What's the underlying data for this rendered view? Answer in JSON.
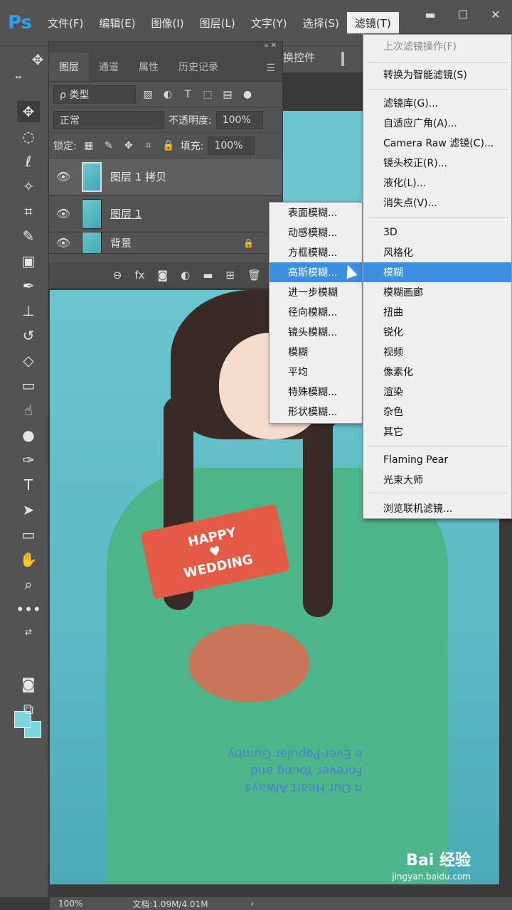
{
  "menubar": {
    "logo": "Ps",
    "items": [
      "文件(F)",
      "编辑(E)",
      "图像(I)",
      "图层(L)",
      "文字(Y)",
      "选择(S)",
      "滤镜(T)"
    ],
    "window_buttons": [
      "▬",
      "☐",
      "✕"
    ]
  },
  "options": {
    "partial_text": "换控件"
  },
  "layers_panel": {
    "tabs": [
      "图层",
      "通道",
      "属性",
      "历史记录"
    ],
    "filter_kind": "ρ 类型",
    "blend_mode": "正常",
    "opacity_label": "不透明度:",
    "opacity_value": "100%",
    "lock_label": "锁定:",
    "fill_label": "填充:",
    "fill_value": "100%",
    "layers": [
      {
        "name": "图层 1 拷贝",
        "selected": true
      },
      {
        "name": "图层 1",
        "selected": false
      },
      {
        "name": "背景",
        "selected": false
      }
    ],
    "footer_icons": [
      "link-icon",
      "fx-icon",
      "mask-icon",
      "adjustment-icon",
      "folder-icon",
      "new-layer-icon",
      "trash-icon"
    ]
  },
  "filter_menu": {
    "items": [
      {
        "label": "上次滤镜操作(F)",
        "disabled": true
      },
      {
        "label": "转换为智能滤镜(S)"
      },
      {
        "label": "滤镜库(G)..."
      },
      {
        "label": "自适应广角(A)..."
      },
      {
        "label": "Camera Raw 滤镜(C)..."
      },
      {
        "label": "镜头校正(R)..."
      },
      {
        "label": "液化(L)..."
      },
      {
        "label": "消失点(V)..."
      },
      {
        "label": "3D"
      },
      {
        "label": "风格化"
      },
      {
        "label": "模糊",
        "highlight": true
      },
      {
        "label": "模糊画廊"
      },
      {
        "label": "扭曲"
      },
      {
        "label": "锐化"
      },
      {
        "label": "视频"
      },
      {
        "label": "像素化"
      },
      {
        "label": "渲染"
      },
      {
        "label": "杂色"
      },
      {
        "label": "其它"
      },
      {
        "label": "Flaming Pear"
      },
      {
        "label": "光束大师"
      },
      {
        "label": "浏览联机滤镜..."
      }
    ]
  },
  "blur_submenu": {
    "items": [
      {
        "label": "表面模糊..."
      },
      {
        "label": "动感模糊..."
      },
      {
        "label": "方框模糊..."
      },
      {
        "label": "高斯模糊...",
        "highlight": true
      },
      {
        "label": "进一步模糊"
      },
      {
        "label": "径向模糊..."
      },
      {
        "label": "镜头模糊..."
      },
      {
        "label": "模糊"
      },
      {
        "label": "平均"
      },
      {
        "label": "特殊模糊..."
      },
      {
        "label": "形状模糊..."
      }
    ]
  },
  "canvas": {
    "sign_line1": "HAPPY",
    "sign_heart": "♥",
    "sign_line2": "WEDDING",
    "shirt_lines": [
      "e Ever-Popular Gumby",
      "Forever Young and",
      "n Our Heart Always"
    ],
    "watermark": "Bai 经验",
    "watermark_url": "jingyan.baidu.com"
  },
  "status": {
    "zoom": "100%",
    "doc": "文档:1.09M/4.01M",
    "arrow": "›"
  },
  "colors": {
    "chrome": "#535353",
    "highlight": "#3a8fe0",
    "canvas_bg": "#6ac5cd",
    "swatch": "#7cd5de"
  }
}
